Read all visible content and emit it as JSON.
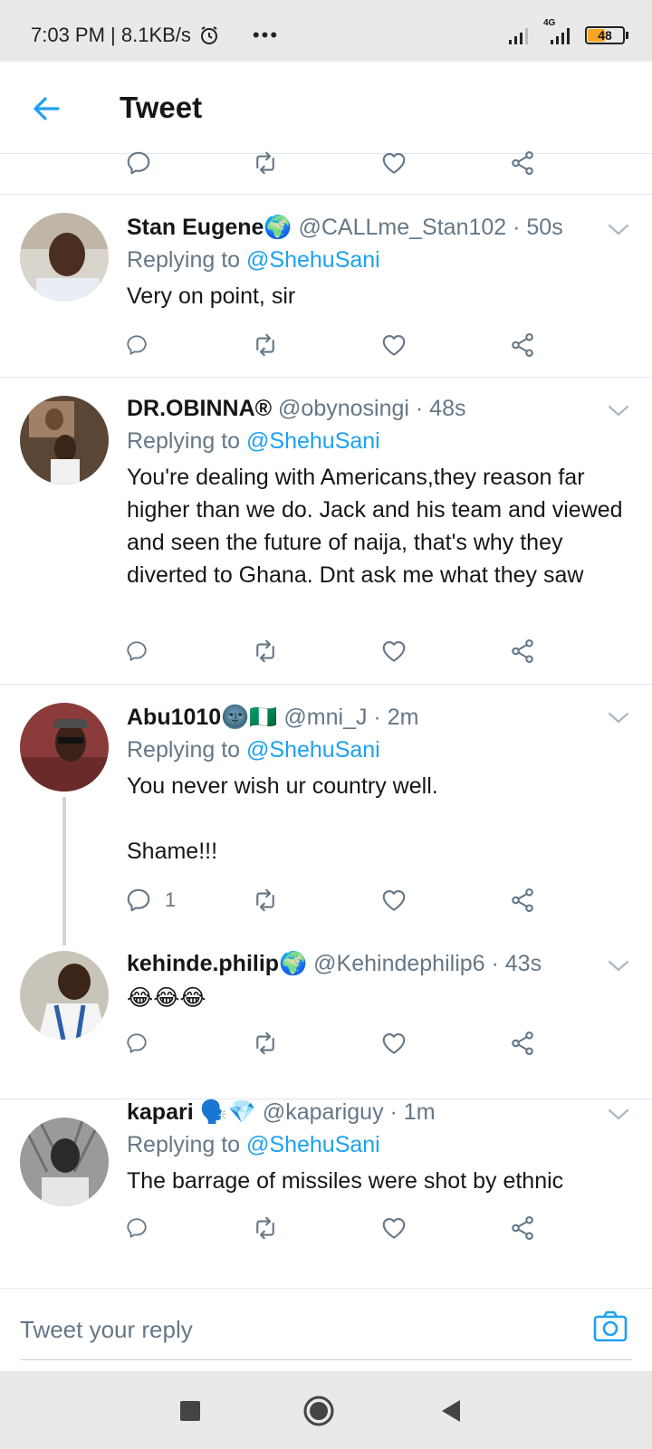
{
  "status_bar": {
    "time": "7:03 PM | 8.1KB/s",
    "dots": "•••",
    "network": "4G",
    "battery": "48",
    "battery_level": 0.48
  },
  "header": {
    "title": "Tweet"
  },
  "tweets": [
    {
      "name": "Stan Eugene🌍",
      "handle": "@CALLme_Stan102 · 50s",
      "replying_prefix": "Replying to ",
      "replying_to": "@ShehuSani",
      "body": "Very on point, sir",
      "reply_count": ""
    },
    {
      "name": "DR.OBINNA®",
      "handle": "@obynosingi · 48s",
      "replying_prefix": "Replying to ",
      "replying_to": "@ShehuSani",
      "body": "You're dealing with Americans,they reason far higher than we do. Jack and his team and viewed and seen the future of naija, that's why they diverted to Ghana. Dnt ask me what they saw",
      "reply_count": ""
    },
    {
      "name": "Abu1010🌚🇳🇬",
      "handle": "@mni_J · 2m",
      "replying_prefix": "Replying to ",
      "replying_to": "@ShehuSani",
      "body": "You never wish ur country well.\n\nShame!!!",
      "reply_count": "1"
    },
    {
      "name": "kehinde.philip🌍",
      "handle": "@Kehindephilip6 · 43s",
      "replying_prefix": "",
      "replying_to": "",
      "body": "😂😂😂",
      "reply_count": ""
    },
    {
      "name": "kapari 🗣️💎",
      "handle": "@kapariguy · 1m",
      "replying_prefix": "Replying to ",
      "replying_to": "@ShehuSani",
      "body": "The barrage of missiles were shot by ethnic",
      "reply_count": ""
    }
  ],
  "reply_bar": {
    "placeholder": "Tweet your reply"
  },
  "icons": {
    "back": "arrow-left-icon",
    "reply": "comment-icon",
    "retweet": "retweet-icon",
    "like": "heart-icon",
    "share": "share-icon",
    "caret": "chevron-down-icon",
    "camera": "camera-icon"
  },
  "colors": {
    "accent": "#1da1f2",
    "muted": "#657786",
    "text": "#14171a"
  }
}
